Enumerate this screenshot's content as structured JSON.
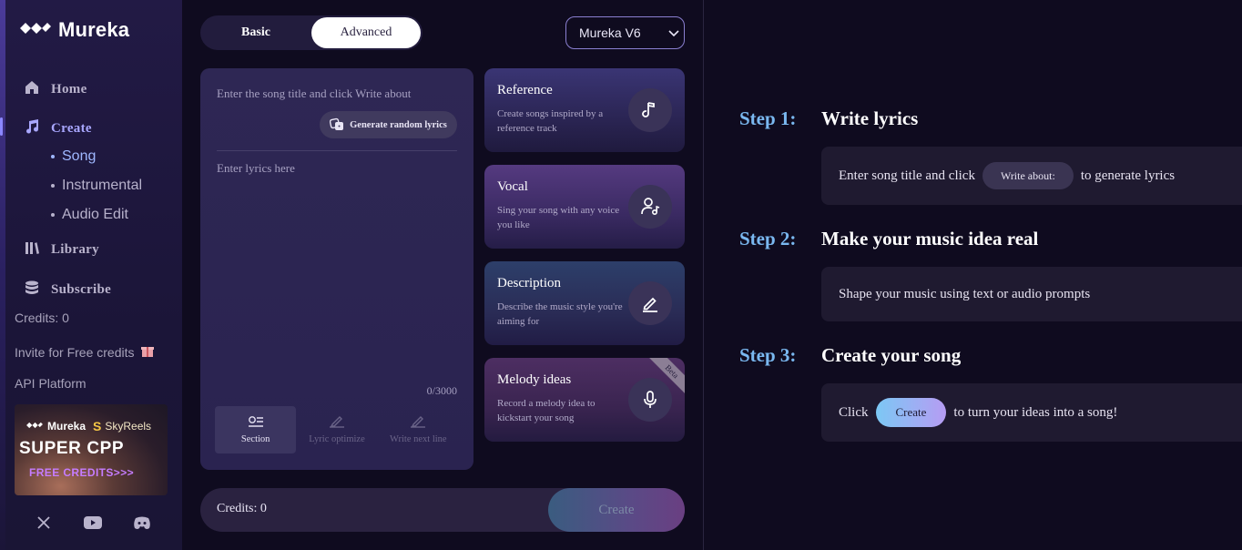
{
  "app": {
    "name": "Mureka"
  },
  "sidebar": {
    "nav": [
      {
        "label": "Home",
        "icon": "home-icon"
      },
      {
        "label": "Create",
        "icon": "music-note-icon",
        "active": true
      },
      {
        "label": "Library",
        "icon": "library-icon"
      },
      {
        "label": "Subscribe",
        "icon": "database-icon"
      }
    ],
    "create_sub": [
      {
        "label": "Song",
        "active": true
      },
      {
        "label": "Instrumental"
      },
      {
        "label": "Audio Edit"
      }
    ],
    "credits": "Credits: 0",
    "invite": "Invite for Free credits",
    "api": "API Platform",
    "promo": {
      "brand1": "Mureka",
      "brand2": "SkyReels",
      "headline": "SUPER CPP",
      "sub": "FREE CREDITS>>>"
    },
    "socials": [
      "x-icon",
      "youtube-icon",
      "discord-icon"
    ]
  },
  "mode": {
    "basic": "Basic",
    "advanced": "Advanced",
    "selected": "Advanced"
  },
  "model": {
    "selected": "Mureka V6"
  },
  "editor": {
    "title_placeholder": "Enter the song title and click Write about",
    "generate_label": "Generate random lyrics",
    "lyrics_placeholder": "Enter lyrics here",
    "counter": "0/3000",
    "tools": [
      {
        "label": "Section",
        "active": true
      },
      {
        "label": "Lyric optimize"
      },
      {
        "label": "Write next line"
      }
    ]
  },
  "cards": [
    {
      "title": "Reference",
      "desc": "Create songs inspired by a reference track",
      "icon": "music-note-icon"
    },
    {
      "title": "Vocal",
      "desc": "Sing your song with any voice you like",
      "icon": "voice-user-icon"
    },
    {
      "title": "Description",
      "desc": "Describe the music style you're aiming for",
      "icon": "pencil-icon"
    },
    {
      "title": "Melody ideas",
      "desc": "Record a melody idea to kickstart your song",
      "icon": "microphone-icon",
      "badge": "Beta"
    }
  ],
  "bottom": {
    "credits": "Credits: 0",
    "create": "Create"
  },
  "steps": [
    {
      "label": "Step 1:",
      "title": "Write lyrics",
      "pre": "Enter song title and click",
      "pill": "Write about:",
      "post": "to generate lyrics"
    },
    {
      "label": "Step 2:",
      "title": "Make your music idea real",
      "text": "Shape your music using text or audio prompts"
    },
    {
      "label": "Step 3:",
      "title": "Create your song",
      "pre": "Click",
      "pill": "Create",
      "post": "to turn your ideas into a song!"
    }
  ],
  "colors": {
    "accent": "#8b87ff",
    "step_label": "#7ab8f0",
    "background": "#0f0b1f"
  }
}
